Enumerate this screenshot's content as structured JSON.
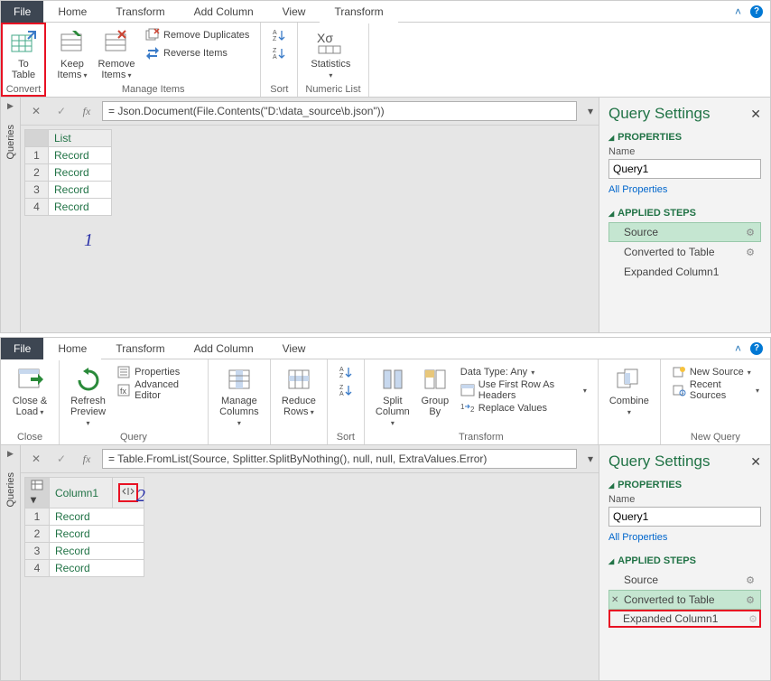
{
  "top": {
    "tabs": {
      "file": "File",
      "home": "Home",
      "transform": "Transform",
      "addcol": "Add Column",
      "view": "View",
      "active": "Transform"
    },
    "ribbon": {
      "to_table": "To\nTable",
      "convert_label": "Convert",
      "keep_items": "Keep\nItems",
      "remove_items": "Remove\nItems",
      "remove_dup": "Remove Duplicates",
      "reverse": "Reverse Items",
      "manage_label": "Manage Items",
      "sort_label": "Sort",
      "statistics": "Statistics",
      "numeric_label": "Numeric List"
    },
    "formula": "= Json.Document(File.Contents(\"D:\\data_source\\b.json\"))",
    "grid": {
      "col": "List",
      "rows": [
        "Record",
        "Record",
        "Record",
        "Record"
      ]
    },
    "settings": {
      "title": "Query Settings",
      "properties": "PROPERTIES",
      "name_label": "Name",
      "name_value": "Query1",
      "all_props": "All Properties",
      "applied": "APPLIED STEPS",
      "steps": [
        "Source",
        "Converted to Table",
        "Expanded Column1"
      ]
    },
    "annot": "1",
    "queries_label": "Queries"
  },
  "bottom": {
    "tabs": {
      "file": "File",
      "home": "Home",
      "transform": "Transform",
      "addcol": "Add Column",
      "view": "View"
    },
    "ribbon": {
      "close_load": "Close &\nLoad",
      "close_label": "Close",
      "refresh": "Refresh\nPreview",
      "properties": "Properties",
      "adv_editor": "Advanced Editor",
      "query_label": "Query",
      "manage_cols": "Manage\nColumns",
      "reduce_rows": "Reduce\nRows",
      "sort_label": "Sort",
      "split_col": "Split\nColumn",
      "group_by": "Group\nBy",
      "datatype": "Data Type: Any",
      "first_row": "Use First Row As Headers",
      "replace": "Replace Values",
      "transform_label": "Transform",
      "combine": "Combine",
      "new_source": "New Source",
      "recent_sources": "Recent Sources",
      "new_query_label": "New Query"
    },
    "formula": "= Table.FromList(Source, Splitter.SplitByNothing(), null, null, ExtraValues.Error)",
    "grid": {
      "col": "Column1",
      "rows": [
        "Record",
        "Record",
        "Record",
        "Record"
      ]
    },
    "settings": {
      "title": "Query Settings",
      "properties": "PROPERTIES",
      "name_label": "Name",
      "name_value": "Query1",
      "all_props": "All Properties",
      "applied": "APPLIED STEPS",
      "steps": [
        "Source",
        "Converted to Table",
        "Expanded Column1"
      ]
    },
    "annot": "2",
    "queries_label": "Queries"
  }
}
